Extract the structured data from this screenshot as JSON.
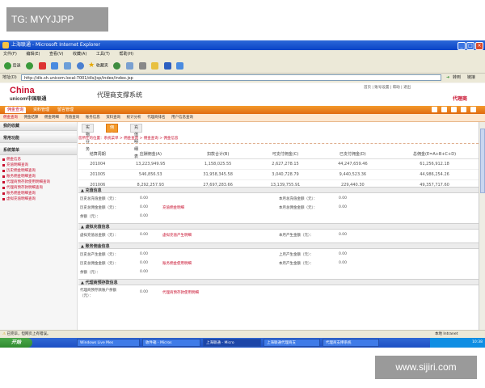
{
  "watermark_top": "TG: MYYJJPP",
  "watermark_bottom": "www.sijiri.com",
  "window": {
    "title": "上海联通 - Microsoft Internet Explorer",
    "menu": [
      "文件(F)",
      "编辑(E)",
      "查看(V)",
      "收藏(A)",
      "工具(T)",
      "帮助(H)"
    ],
    "toolbar": {
      "back": "后退",
      "favorites": "收藏夹"
    },
    "address_label": "地址(D)",
    "address_value": "http://dls.sh.unicom.local:7001/dls/jsp/index/index.jsp",
    "go_label": "转到",
    "links_label": "链接"
  },
  "page": {
    "logo_top": "China",
    "logo_bottom": "unicom中国联通",
    "system_title": "代理商支撑系统",
    "top_links": "首页 | 账号设置 | 帮助 | 退出",
    "top_brand": "代理商",
    "nav1": [
      "佣金查询",
      "资料管理",
      "留言管理"
    ],
    "nav2": [
      "佣金查询",
      "佣金结算",
      "佣金明细",
      "充值查询",
      "账务信息",
      "资料查询",
      "统计分析",
      "代理商排名",
      "用户信息查询"
    ],
    "sidebar": {
      "section1": "我的收藏",
      "section2": "常用功能",
      "section3": "系统菜单",
      "items": [
        "佣金信息",
        "充值明细查询",
        "历史佣金明细查询",
        "账务佣金明细查询",
        "代理商预存款使用明细查询",
        "代理商预存款明细查询",
        "账务佣金明细查询",
        "虚拟充值明细查询"
      ]
    },
    "tabs": [
      "实物业务",
      "佣金信息",
      "充值明细表"
    ],
    "breadcrumb": "您所在的位置：系统菜单 > 佣金查询 > 佣金查询 > 佣金信息",
    "summary": {
      "headers": [
        "结算周期",
        "应酬佣金(A)",
        "扣款合计(B)",
        "可支付佣金(C)",
        "已支付佣金(D)",
        "总佣金(E=A+B+C+D)"
      ],
      "rows": [
        [
          "201004",
          "13,223,949.95",
          "1,158,025.55",
          "2,627,278.15",
          "44,247,659.46",
          "61,256,912.18"
        ],
        [
          "201005",
          "546,856.53",
          "31,958,345.58",
          "3,040,728.79",
          "9,440,523.36",
          "44,986,254.26"
        ],
        [
          "201006",
          "8,292,257.93",
          "27,697,283.66",
          "13,139,755.91",
          "229,440.30",
          "49,357,717.60"
        ]
      ]
    },
    "sec1": {
      "title": "充值信息",
      "label1": "历史总充值金额（元）：",
      "value1": "0.00",
      "label2": "历史总佣金金额（元）：",
      "value2": "0.00",
      "link2": "充值佣金明细",
      "label3": "余额（元）：",
      "value3": "0.00",
      "rlabel1": "本月总充值金额（元）：",
      "rvalue1": "0.00",
      "rlabel2": "本月总佣金金额（元）：",
      "rvalue2": "0.00"
    },
    "sec2": {
      "title": "虚拟充值信息",
      "label1": "虚拟充值总金额（元）：",
      "value1": "0.00",
      "link1": "虚拟充值产生明细",
      "rlabel1": "本月产生金额（元）：",
      "rvalue1": "0.00"
    },
    "sec3": {
      "title": "账务佣金信息",
      "label1": "历史总产生金额（元）：",
      "value1": "0.00",
      "label2": "历史总佣金金额（元）：",
      "value2": "0.00",
      "link2": "账务佣金使用明细",
      "label3": "余额（元）：",
      "value3": "0.00",
      "rlabel1": "上月产生金额（元）：",
      "rvalue1": "0.00",
      "rlabel2": "本月产生金额（元）：",
      "rvalue2": "0.00"
    },
    "sec4": {
      "title": "代理商预存款信息",
      "label1a": "代理商预存款账户余额",
      "label1b": "（元）：",
      "value1": "0.00",
      "link1": "代理商预存款使用明细"
    }
  },
  "status": {
    "left": "已完毕，但网页上有错误。",
    "right": "本地 Intranet"
  },
  "taskbar": {
    "start": "开始",
    "tasks": [
      "Windows Live Mes",
      "收件箱 - Micros",
      "上海联通 - Micro",
      "上海联通代理商支",
      "代理商支撑系统"
    ],
    "clock": "10:38"
  }
}
